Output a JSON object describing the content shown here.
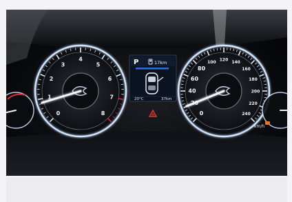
{
  "tachometer": {
    "numbers": [
      "0",
      "1",
      "2",
      "3",
      "4",
      "5",
      "6",
      "7",
      "8"
    ]
  },
  "speedometer": {
    "numbers": [
      "0",
      "20",
      "40",
      "60",
      "80",
      "100",
      "120",
      "140",
      "160",
      "180",
      "200",
      "220",
      "240"
    ],
    "unit": "km/h"
  },
  "center_display": {
    "gear": "P",
    "fuel_range": "17km",
    "outside_temp": "20°C",
    "distance": "37km"
  },
  "icons": [
    "fuel-pump-icon",
    "car-top-view-icon",
    "warning-triangle-icon",
    "engine-warning-icon"
  ],
  "colors": {
    "gauge_glow": "#cfe4ff",
    "redline": "#e3283a",
    "display_blue": "#2a6fe0",
    "warning": "#e23b2b"
  }
}
